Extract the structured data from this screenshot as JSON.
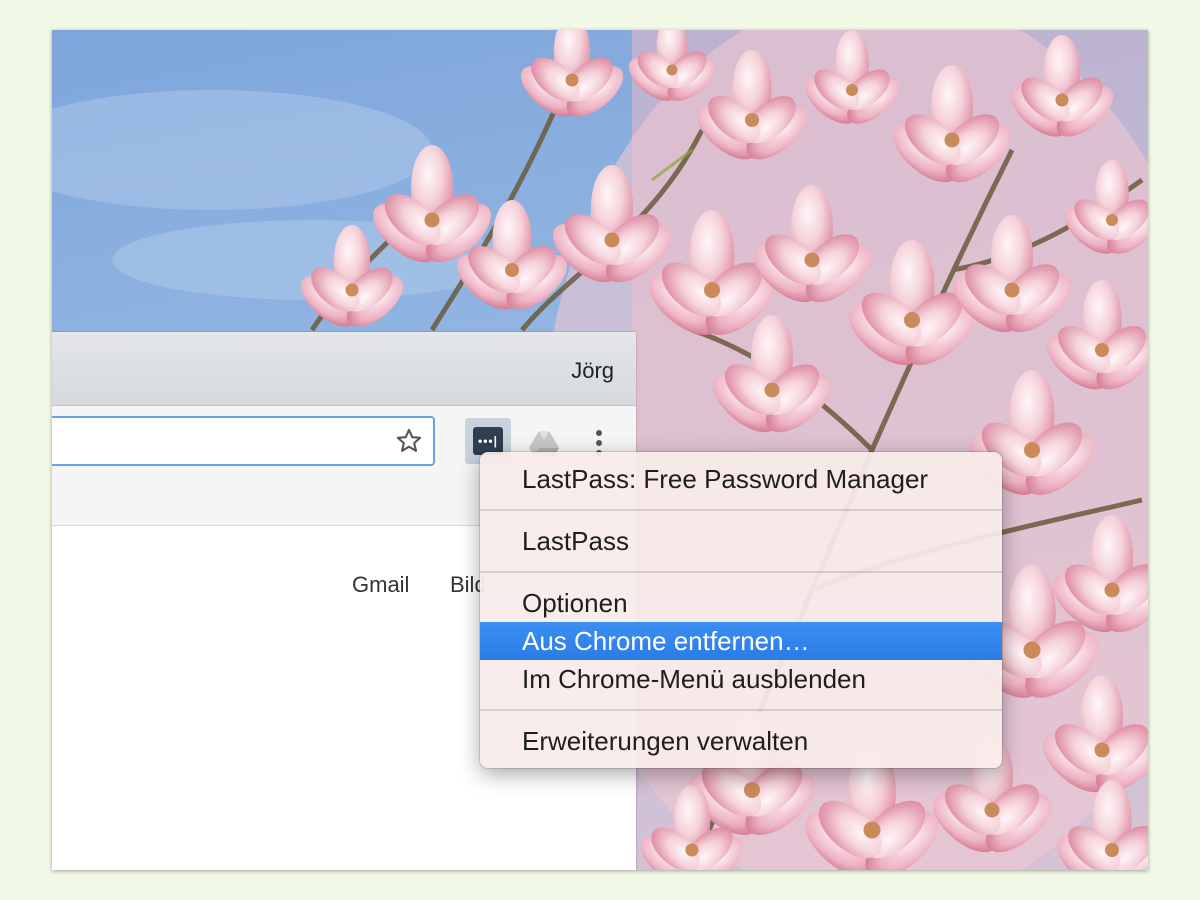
{
  "browser": {
    "profile_name": "Jörg",
    "omnibox": {
      "value": ""
    },
    "toolbar_icons": [
      "star-icon",
      "lastpass-icon",
      "google-drive-icon",
      "kebab-menu-icon"
    ],
    "lastpass_glyph": "•••|",
    "page_links": {
      "gmail": "Gmail",
      "images": "Bilder"
    }
  },
  "context_menu": {
    "title": "LastPass: Free Password Manager",
    "items": [
      {
        "label": "LastPass"
      },
      {
        "label": "Optionen"
      },
      {
        "label": "Aus Chrome entfernen…",
        "highlighted": true
      },
      {
        "label": "Im Chrome-Menü ausblenden"
      },
      {
        "label": "Erweiterungen verwalten"
      }
    ]
  },
  "colors": {
    "page_background": "#f2f9e6",
    "sky": "#8fb3e0",
    "blossom": "#f0c4d0",
    "highlight": "#2b7be6",
    "omnibox_border": "#6aa2e8"
  }
}
